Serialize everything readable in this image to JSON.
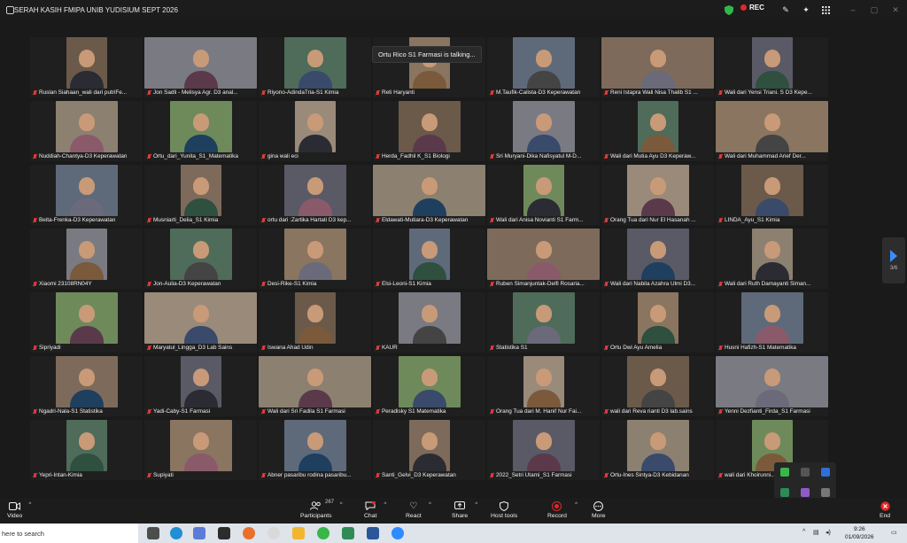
{
  "window": {
    "title": "SERAH KASIH FMIPA UNIB YUDISIUM SEPT 2026",
    "recording_label": "REC"
  },
  "talking_banner": "Ortu Rico S1 Farmasi is talking...",
  "page_indicator": "3/6",
  "participants": [
    "Ruslan Siahaan_wali dari putriFe...",
    "Jon Sadli - Melisya Agr. D3 anal...",
    "Riyono-AdindaTria-S1 Kimia",
    "Reti Haryanti",
    "M.Taufik-Calista-D3 Keperawatan",
    "Reni Istapra Wali Nisa Thalib S1 ...",
    "Wali dari Yensi Triani. S D3 Kepe...",
    "Nuddiah-Chantya-D3 Keperawatan",
    "Ortu_dari_Yunita_S1_Matematika",
    "gina wali eci",
    "Herda_Fadhil K_S1 Biologi",
    "Sri Muryani-Dika Nafisyatul M-D...",
    "Wali dari Mutia Ayu D3 Keperaw...",
    "Wali dari Muhammad Arief Der...",
    "Beita-Frenka-D3 Keperawatan",
    "Musniarti_Delia_S1 Kimia",
    "ortu dari :Zartika Hartati D3 kep...",
    "Eldawati-Mutiara-D3 Keperawatan",
    "Wali dari Anisa Novianti S1 Farm...",
    "Orang Tua dari Nur El Hasanah ...",
    "LINDA_Ayu_S1 Kimia",
    "Xiaomi 23108RN04Y",
    "Jon-Aulia-D3 Keperawatan",
    "Desi-Rike-S1 Kimia",
    "Elsi-Leoni-S1 Kimia",
    "Ruben Simanjuntak-Delfi Rosaria...",
    "Wali dari Nabila Azahra Ulmi D3...",
    "Wali dari Ruth Damayanti Siman...",
    "Sipriyadi",
    "Maryatul_Lingga_D3 Lab Sains",
    "Iswana Ahad Udin",
    "KAUR",
    "Statistika S1",
    "Ortu Dwi Ayu Amelia",
    "Husni Hafizh-S1 Matematika",
    "Ngadri-Nala-S1 Statistika",
    "Yadi-Caby-S1 Farmasi",
    "Wali dari Sri Fadila S1 Farmasi",
    "Peradisky S1 Matematika",
    "Orang Tua dari M. Hanif Nur Fai...",
    "wali dari Reva rianti D3 lab.sains",
    "Yenni Dezfianti_Firda_S1 Farmasi",
    "Yepri-Intan-Kimia",
    "Supiyati",
    "Abner pasaribu rodina pasaribu...",
    "Santi_Gelvi_D3 Keperawatan",
    "2022_Setri Utami_S1 Farmasi",
    "Ortu-Ines Sintya-D3 Kebidanan",
    "wali dari Khoirunni..."
  ],
  "toolbar": {
    "video": "Video",
    "participants": "Participants",
    "participants_count": "267",
    "chat": "Chat",
    "react": "React",
    "share": "Share",
    "host_tools": "Host tools",
    "record": "Record",
    "more": "More",
    "end": "End"
  },
  "taskbar": {
    "search_placeholder": "here to search",
    "time": "9:26",
    "date": "01/09/2026"
  },
  "colors": {
    "accent": "#3d8bfd",
    "record": "#e02828",
    "muted_mic": "#e23b3b"
  }
}
